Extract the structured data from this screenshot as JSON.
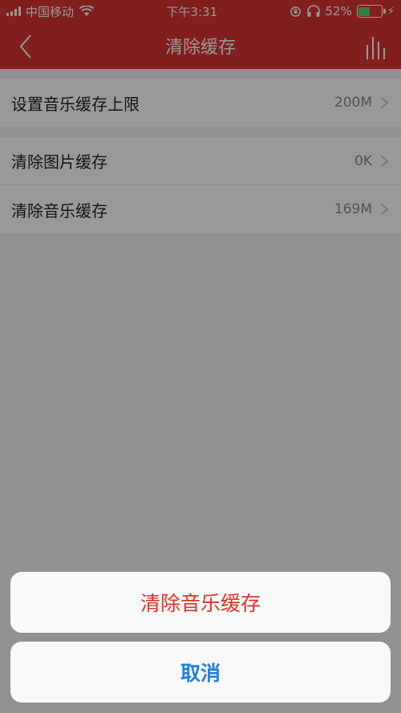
{
  "status_bar": {
    "carrier": "中国移动",
    "time": "下午3:31",
    "battery": "52%",
    "battery_level": 0.52
  },
  "nav": {
    "title": "清除缓存"
  },
  "settings": {
    "music_limit": {
      "label": "设置音乐缓存上限",
      "value": "200M"
    },
    "clear_images": {
      "label": "清除图片缓存",
      "value": "0K"
    },
    "clear_music": {
      "label": "清除音乐缓存",
      "value": "169M"
    }
  },
  "action_sheet": {
    "confirm_label": "清除音乐缓存",
    "cancel_label": "取消"
  },
  "colors": {
    "brand_red": "#d7342f",
    "destructive": "#e0322c",
    "cancel_blue": "#1f7fe0"
  }
}
